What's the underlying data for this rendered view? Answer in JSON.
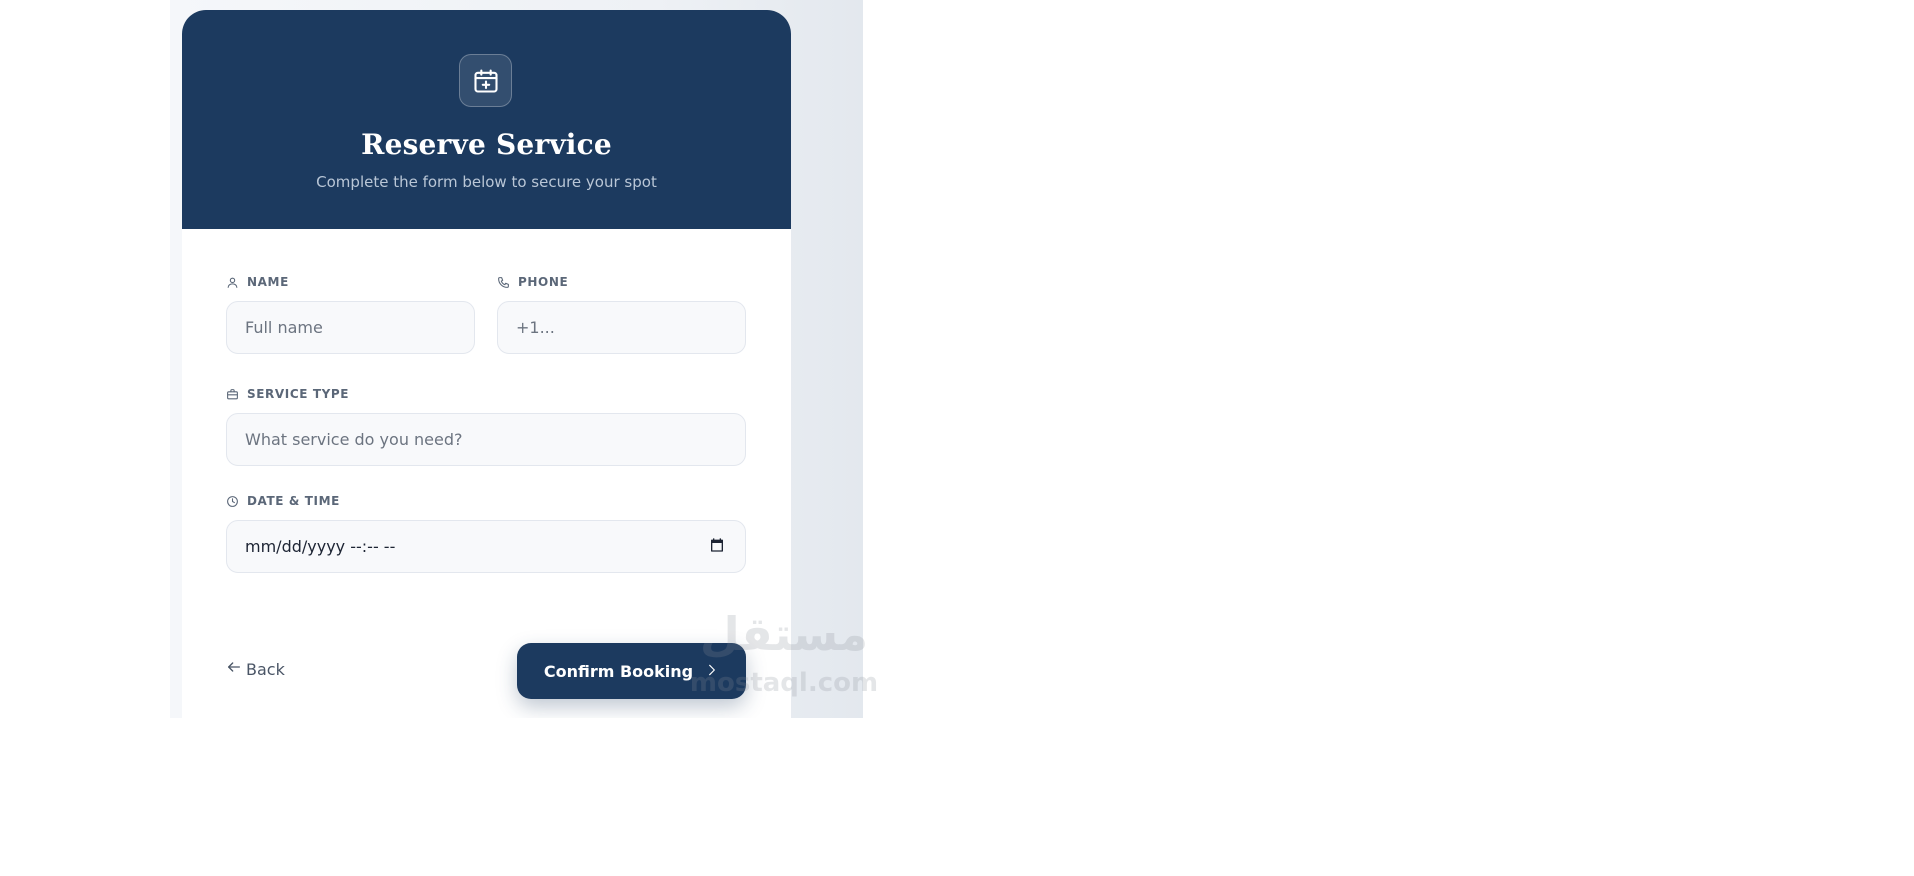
{
  "header": {
    "icon": "calendar-plus-icon",
    "title": "Reserve Service",
    "subtitle": "Complete the form below to secure your spot"
  },
  "form": {
    "name": {
      "label": "NAME",
      "icon": "user-icon",
      "placeholder": "Full name",
      "value": ""
    },
    "phone": {
      "label": "PHONE",
      "icon": "phone-icon",
      "placeholder": "+1...",
      "value": ""
    },
    "service": {
      "label": "SERVICE TYPE",
      "icon": "briefcase-icon",
      "placeholder": "What service do you need?",
      "value": ""
    },
    "datetime": {
      "label": "DATE & TIME",
      "icon": "clock-icon",
      "value": "mm/dd/yyyy --:-- --",
      "picker_icon": "calendar-icon"
    }
  },
  "actions": {
    "back_label": "Back",
    "confirm_label": "Confirm Booking"
  },
  "watermark": {
    "arabic": "مستقل",
    "latin": "mostaql.com"
  },
  "colors": {
    "primary": "#1c3a5f",
    "label": "#5b6778",
    "input_bg": "#f8f9fb",
    "input_border": "#e3e7ee"
  }
}
